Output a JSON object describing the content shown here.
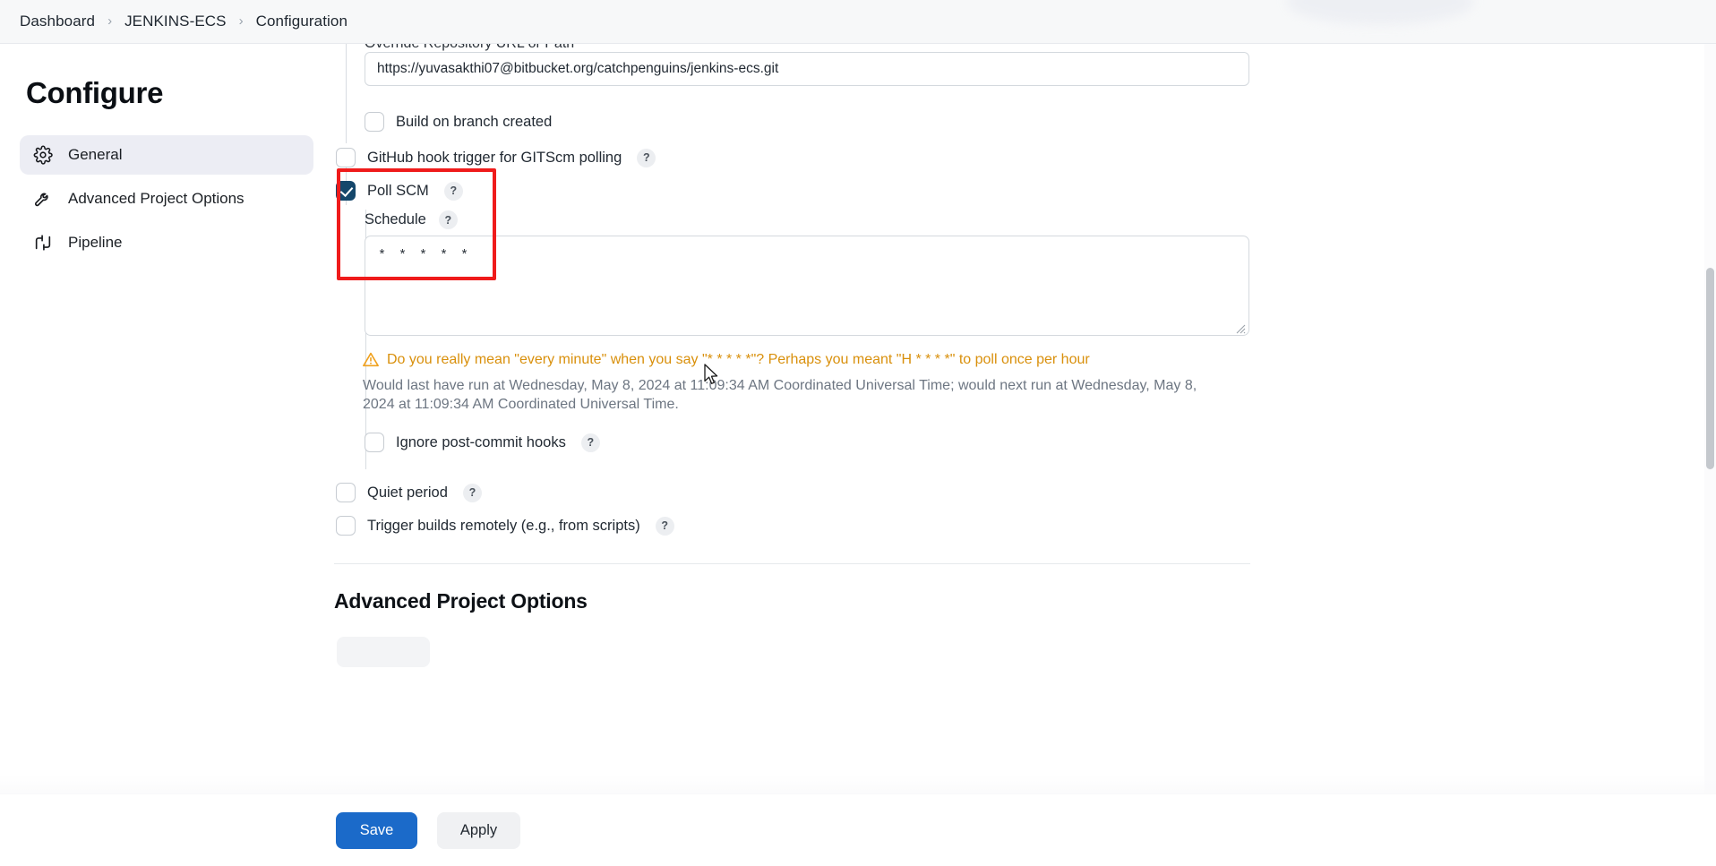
{
  "breadcrumb": {
    "items": [
      "Dashboard",
      "JENKINS-ECS",
      "Configuration"
    ],
    "separator": "›"
  },
  "sidebar": {
    "title": "Configure",
    "items": [
      {
        "label": "General",
        "icon": "gear-icon",
        "active": true
      },
      {
        "label": "Advanced Project Options",
        "icon": "wrench-icon",
        "active": false
      },
      {
        "label": "Pipeline",
        "icon": "pipeline-icon",
        "active": false
      }
    ]
  },
  "main": {
    "repo_url_label": "Override Repository URL or Path",
    "repo_url_value": "https://yuvasakthi07@bitbucket.org/catchpenguins/jenkins-ecs.git",
    "build_on_branch_created": {
      "label": "Build on branch created",
      "checked": false
    },
    "github_hook_trigger": {
      "label": "GitHub hook trigger for GITScm polling",
      "checked": false,
      "help": "?"
    },
    "poll_scm": {
      "label": "Poll SCM",
      "checked": true,
      "help": "?"
    },
    "schedule": {
      "label": "Schedule",
      "help": "?",
      "value": "* * * * *"
    },
    "warning": {
      "icon": "warning-triangle-icon",
      "text": "Do you really mean \"every minute\" when you say \"* * * * *\"? Perhaps you meant \"H * * * *\" to poll once per hour",
      "detail": "Would last have run at Wednesday, May 8, 2024 at 11:09:34 AM Coordinated Universal Time; would next run at Wednesday, May 8, 2024 at 11:09:34 AM Coordinated Universal Time."
    },
    "ignore_post_commit_hooks": {
      "label": "Ignore post-commit hooks",
      "checked": false,
      "help": "?"
    },
    "quiet_period": {
      "label": "Quiet period",
      "checked": false,
      "help": "?"
    },
    "trigger_builds_remotely": {
      "label": "Trigger builds remotely (e.g., from scripts)",
      "checked": false,
      "help": "?"
    },
    "advanced_section_title": "Advanced Project Options"
  },
  "footer": {
    "save_label": "Save",
    "apply_label": "Apply"
  },
  "annotation": {
    "color": "#ef1b1b"
  },
  "colors": {
    "accent": "#1b6ac9",
    "checkbox_checked": "#14476b",
    "warning": "#d9900c",
    "annotation_red": "#ef1b1b",
    "sidebar_active_bg": "#ecedf4"
  }
}
